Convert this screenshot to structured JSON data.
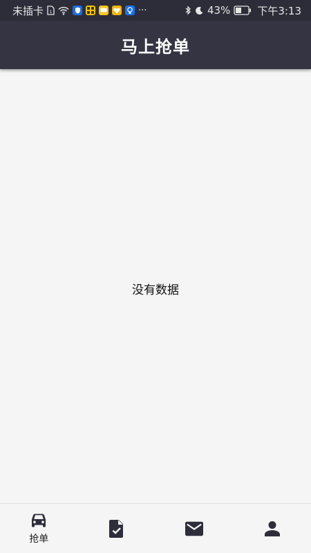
{
  "status_bar": {
    "carrier": "未插卡",
    "battery": "43%",
    "time": "下午3:13",
    "more": "···",
    "icons": [
      "sim-icon",
      "wifi-icon",
      "shield-app-icon",
      "app-badge-icon",
      "message-app-icon",
      "heart-app-icon",
      "bulb-app-icon",
      "bluetooth-icon",
      "moon-icon",
      "battery-icon"
    ]
  },
  "header": {
    "title": "马上抢单"
  },
  "main": {
    "empty_text": "没有数据"
  },
  "bottom_nav": {
    "items": [
      {
        "label": "抢单",
        "icon": "car-icon",
        "active": true
      },
      {
        "label": "",
        "icon": "document-check-icon",
        "active": false
      },
      {
        "label": "",
        "icon": "mail-icon",
        "active": false
      },
      {
        "label": "",
        "icon": "person-icon",
        "active": false
      }
    ]
  },
  "colors": {
    "status_bar_bg": "#2d2d3a",
    "header_bg": "#353443",
    "page_bg": "#f5f5f5",
    "icon_color": "#2e2d3a"
  }
}
